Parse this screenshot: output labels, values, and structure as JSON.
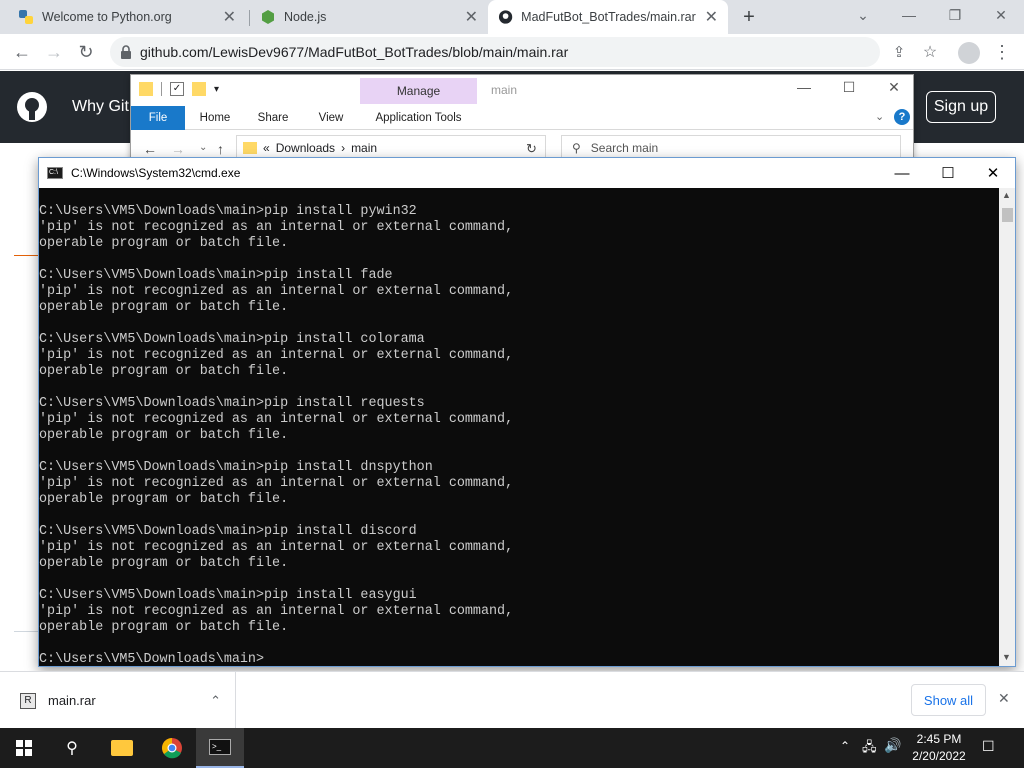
{
  "browser": {
    "tabs": [
      {
        "title": "Welcome to Python.org",
        "icon": "python-icon"
      },
      {
        "title": "Node.js",
        "icon": "nodejs-icon"
      },
      {
        "title": "MadFutBot_BotTrades/main.rar a",
        "icon": "github-icon"
      }
    ],
    "url": "github.com/LewisDev9677/MadFutBot_BotTrades/blob/main/main.rar"
  },
  "github": {
    "why_label": "Why Git",
    "signup_label": "Sign up"
  },
  "explorer": {
    "manage_label": "Manage",
    "title": "main",
    "tabs": [
      "File",
      "Home",
      "Share",
      "View",
      "Application Tools"
    ],
    "breadcrumb": [
      "Downloads",
      "main"
    ],
    "search_placeholder": "Search main"
  },
  "cmd": {
    "title": "C:\\Windows\\System32\\cmd.exe",
    "lines": [
      "C:\\Users\\VM5\\Downloads\\main>pip install pywin32",
      "'pip' is not recognized as an internal or external command,",
      "operable program or batch file.",
      "",
      "C:\\Users\\VM5\\Downloads\\main>pip install fade",
      "'pip' is not recognized as an internal or external command,",
      "operable program or batch file.",
      "",
      "C:\\Users\\VM5\\Downloads\\main>pip install colorama",
      "'pip' is not recognized as an internal or external command,",
      "operable program or batch file.",
      "",
      "C:\\Users\\VM5\\Downloads\\main>pip install requests",
      "'pip' is not recognized as an internal or external command,",
      "operable program or batch file.",
      "",
      "C:\\Users\\VM5\\Downloads\\main>pip install dnspython",
      "'pip' is not recognized as an internal or external command,",
      "operable program or batch file.",
      "",
      "C:\\Users\\VM5\\Downloads\\main>pip install discord",
      "'pip' is not recognized as an internal or external command,",
      "operable program or batch file.",
      "",
      "C:\\Users\\VM5\\Downloads\\main>pip install easygui",
      "'pip' is not recognized as an internal or external command,",
      "operable program or batch file.",
      "",
      "C:\\Users\\VM5\\Downloads\\main>"
    ]
  },
  "downloads": {
    "file_name": "main.rar",
    "show_all_label": "Show all"
  },
  "taskbar": {
    "time": "2:45 PM",
    "date": "2/20/2022"
  }
}
